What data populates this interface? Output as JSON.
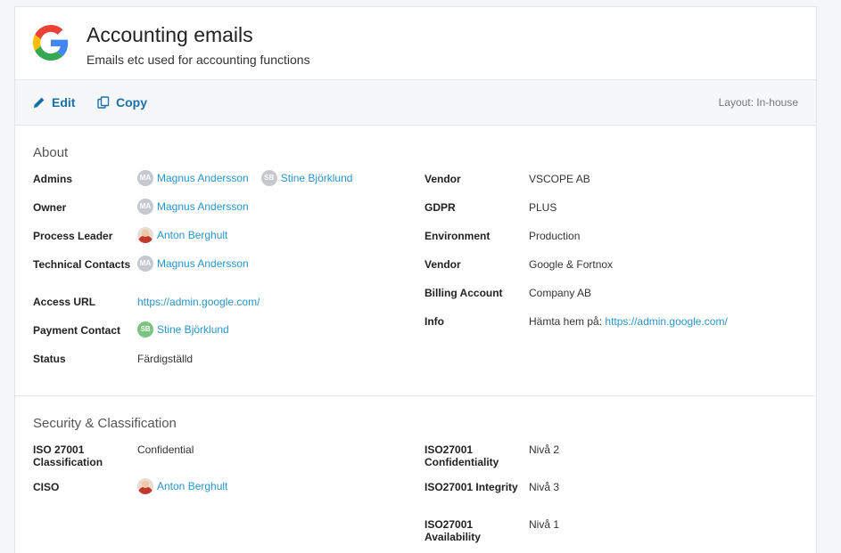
{
  "header": {
    "title": "Accounting emails",
    "subtitle": "Emails etc used for accounting functions",
    "logo_icon": "google-logo",
    "colors": {
      "blue": "#4285F4",
      "red": "#EA4335",
      "yellow": "#FBBC05",
      "green": "#34A853"
    }
  },
  "toolbar": {
    "edit_label": "Edit",
    "copy_label": "Copy",
    "layout_label": "Layout: In-house",
    "accent": "#1a6fa8"
  },
  "about": {
    "title": "About",
    "admins_label": "Admins",
    "admins": [
      {
        "initials": "MA",
        "name": "Magnus Andersson"
      },
      {
        "initials": "SB",
        "name": "Stine Björklund"
      }
    ],
    "owner_label": "Owner",
    "owner": {
      "initials": "MA",
      "name": "Magnus Andersson"
    },
    "process_leader_label": "Process Leader",
    "process_leader": {
      "name": "Anton Berghult"
    },
    "technical_contacts_label": "Technical Contacts",
    "technical_contacts": {
      "initials": "MA",
      "name": "Magnus Andersson"
    },
    "access_url_label": "Access URL",
    "access_url": "https://admin.google.com/",
    "payment_contact_label": "Payment Contact",
    "payment_contact": {
      "initials": "SB",
      "name": "Stine Björklund"
    },
    "status_label": "Status",
    "status": "Färdigställd",
    "vendor_label": "Vendor",
    "vendor": "VSCOPE AB",
    "gdpr_label": "GDPR",
    "gdpr": "PLUS",
    "environment_label": "Environment",
    "environment": "Production",
    "vendor2_label": "Vendor",
    "vendor2": "Google & Fortnox",
    "billing_label": "Billing Account",
    "billing": "Company AB",
    "info_label": "Info",
    "info_prefix": "Hämta hem på:",
    "info_link": "https://admin.google.com/"
  },
  "security": {
    "title": "Security & Classification",
    "iso_class_label": "ISO 27001 Classification",
    "iso_class": "Confidential",
    "ciso_label": "CISO",
    "ciso": {
      "name": "Anton Berghult"
    },
    "conf_label": "ISO27001 Confidentiality",
    "conf": "Nivå 2",
    "integ_label": "ISO27001 Integrity",
    "integ": "Nivå 3",
    "avail_label": "ISO27001 Availability",
    "avail": "Nivå 1"
  }
}
